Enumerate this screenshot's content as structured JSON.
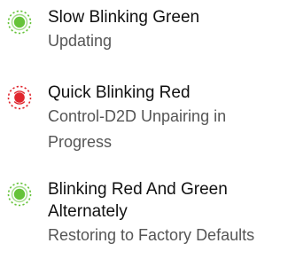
{
  "colors": {
    "green": "#66c33a",
    "red": "#e0262e"
  },
  "items": [
    {
      "icon": "led-slow-blink-green-icon",
      "title": "Slow Blinking Green",
      "description": "Updating"
    },
    {
      "icon": "led-quick-blink-red-icon",
      "title": "Quick Blinking Red",
      "description": "Control-D2D Unpairing in Progress"
    },
    {
      "icon": "led-alternate-red-green-icon",
      "title": "Blinking Red And Green Alternately",
      "description": "Restoring to Factory Defaults"
    }
  ]
}
